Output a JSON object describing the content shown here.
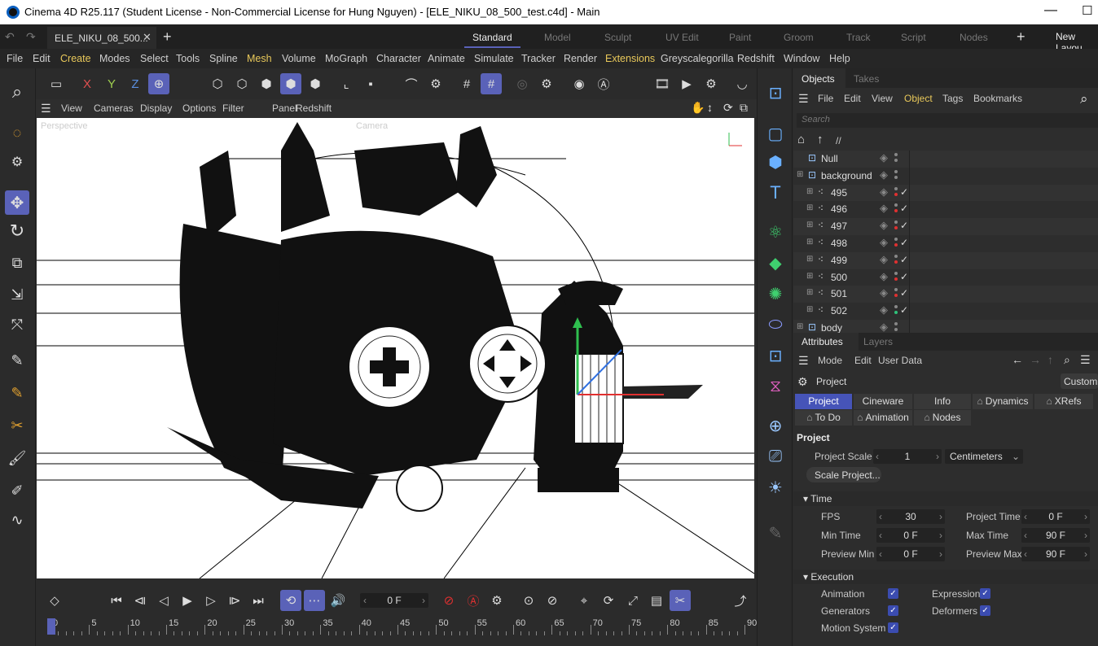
{
  "window": {
    "title": "Cinema 4D R25.117 (Student License - Non-Commercial License for Hung Nguyen) - [ELE_NIKU_08_500_test.c4d] - Main"
  },
  "tabs": {
    "doc_tab": "ELE_NIKU_08_500...",
    "layouts": [
      "Standard",
      "Model",
      "Sculpt",
      "UV Edit",
      "Paint",
      "Groom",
      "Track",
      "Script",
      "Nodes"
    ],
    "active_layout": "Standard",
    "new_layout": "New Layou"
  },
  "menu": [
    "File",
    "Edit",
    "Create",
    "Modes",
    "Select",
    "Tools",
    "Spline",
    "Mesh",
    "Volume",
    "MoGraph",
    "Character",
    "Animate",
    "Simulate",
    "Tracker",
    "Render",
    "Extensions",
    "Greyscalegorilla",
    "Redshift",
    "Window",
    "Help"
  ],
  "toolbar": {
    "x": "X",
    "y": "Y",
    "z": "Z"
  },
  "viewport_menu": [
    "View",
    "Cameras",
    "Display",
    "Options",
    "Filter",
    "Panel",
    "Redshift"
  ],
  "viewport": {
    "camera_label": "Perspective",
    "default_camera": "Camera"
  },
  "timeline": {
    "current_frame": "0 F",
    "ruler": [
      "0",
      "5",
      "10",
      "15",
      "20",
      "25",
      "30",
      "35",
      "40",
      "45",
      "50",
      "55",
      "60",
      "65",
      "70",
      "75",
      "80",
      "85",
      "90"
    ]
  },
  "objects_panel": {
    "tabs": [
      "Objects",
      "Takes"
    ],
    "menu": [
      "File",
      "Edit",
      "View",
      "Object",
      "Tags",
      "Bookmarks"
    ],
    "search_placeholder": "Search",
    "path": "//",
    "items": [
      {
        "name": "Null",
        "dot": "#888888",
        "check": ""
      },
      {
        "name": "background",
        "dot": "#888888",
        "check": ""
      },
      {
        "name": "495",
        "dot": "#e03030",
        "check": "✓"
      },
      {
        "name": "496",
        "dot": "#e03030",
        "check": "✓"
      },
      {
        "name": "497",
        "dot": "#e03030",
        "check": "✓"
      },
      {
        "name": "498",
        "dot": "#e03030",
        "check": "✓"
      },
      {
        "name": "499",
        "dot": "#e03030",
        "check": "✓"
      },
      {
        "name": "500",
        "dot": "#e03030",
        "check": "✓"
      },
      {
        "name": "501",
        "dot": "#e03030",
        "check": "✓"
      },
      {
        "name": "502",
        "dot": "#2fc27a",
        "check": "✓"
      },
      {
        "name": "body",
        "dot": "#888888",
        "check": ""
      }
    ]
  },
  "attributes_panel": {
    "tabs": [
      "Attributes",
      "Layers"
    ],
    "menu": [
      "Mode",
      "Edit",
      "User Data"
    ],
    "object_label": "Project",
    "custom_label": "Custom",
    "subtabs_row1": [
      "Project",
      "Cineware",
      "Info",
      "Dynamics",
      "XRefs"
    ],
    "subtabs_row2": [
      "To Do",
      "Animation",
      "Nodes"
    ],
    "section_title": "Project",
    "project_scale_label": "Project Scale",
    "project_scale_value": "1",
    "project_scale_unit": "Centimeters",
    "scale_project_button": "Scale Project...",
    "time_section": "Time",
    "fps_label": "FPS",
    "fps": "30",
    "project_time_label": "Project Time",
    "project_time": "0 F",
    "min_time_label": "Min Time",
    "min_time": "0 F",
    "max_time_label": "Max Time",
    "max_time": "90 F",
    "preview_min_label": "Preview Min",
    "preview_min": "0 F",
    "preview_max_label": "Preview Max",
    "preview_max": "90 F",
    "execution_section": "Execution",
    "animation_label": "Animation",
    "expression_label": "Expression",
    "generators_label": "Generators",
    "deformers_label": "Deformers",
    "motion_system_label": "Motion System"
  },
  "colors": {
    "accent": "#5a62b8",
    "highlight_text": "#e8c85a",
    "active_tab": "#4654b8"
  }
}
